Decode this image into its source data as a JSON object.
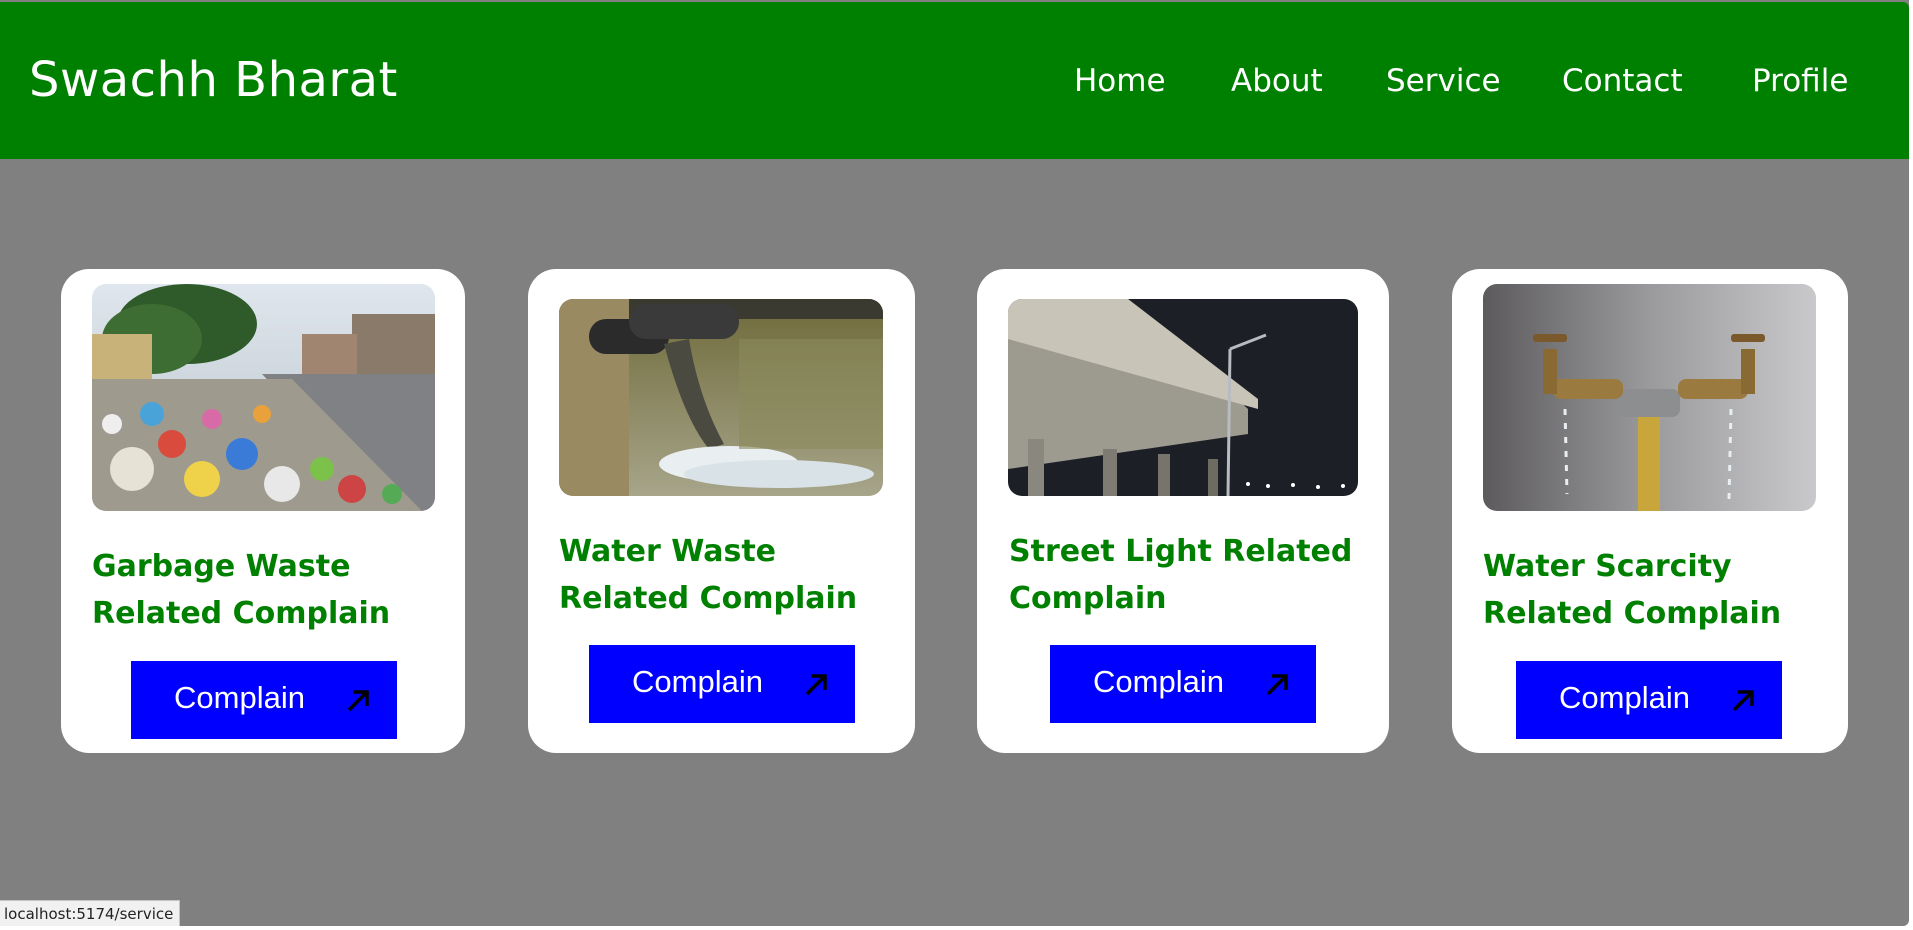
{
  "navbar": {
    "brand": "Swachh Bharat",
    "links": [
      "Home",
      "About",
      "Service",
      "Contact",
      "Profile"
    ]
  },
  "cards": [
    {
      "title_line1": "Garbage Waste",
      "title_line2": "Related Complain",
      "button": "Complain",
      "image": "garbage-pile-photo"
    },
    {
      "title_line1": "Water Waste",
      "title_line2": "Related Complain",
      "button": "Complain",
      "image": "sewage-pipe-photo"
    },
    {
      "title_line1": "Street Light Related",
      "title_line2": "Complain",
      "button": "Complain",
      "image": "flyover-street-light-photo"
    },
    {
      "title_line1": "Water Scarcity",
      "title_line2": "Related Complain",
      "button": "Complain",
      "image": "dripping-taps-photo"
    }
  ],
  "status_bar": {
    "url": "localhost:5174/service"
  },
  "colors": {
    "navbar_bg": "#008000",
    "page_bg": "#808080",
    "card_bg": "#ffffff",
    "title_text": "#008000",
    "button_bg": "#0000ff",
    "button_text": "#ffffff"
  },
  "icons": {
    "button_icon": "arrow-up-right-icon"
  }
}
